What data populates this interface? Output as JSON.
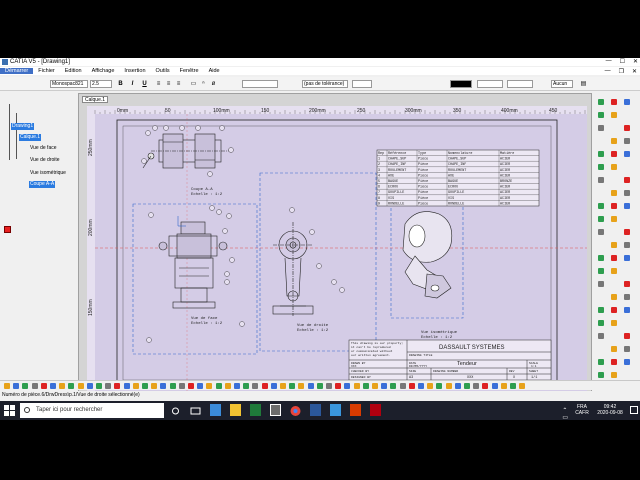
{
  "window": {
    "title": "CATIA V5 - [Drawing1]",
    "controls": [
      "—",
      "☐",
      "✕"
    ],
    "inner_controls": [
      "—",
      "❐",
      "✕"
    ]
  },
  "menu": {
    "items": [
      "Démarrer",
      "Fichier",
      "Edition",
      "Affichage",
      "Insertion",
      "Outils",
      "Fenêtre",
      "Aide"
    ],
    "active_index": 0
  },
  "toolbar": {
    "font_name": "Monospac821",
    "font_size": "2.5",
    "bold": "B",
    "italic": "I",
    "underline": "U",
    "tolerance": "(pas de tolérance)",
    "line_type": "Aucun"
  },
  "tree": {
    "root": "Drawing1",
    "sheet": "Calque.1",
    "views": [
      "Vue de face",
      "Vue de droite",
      "Vue isométrique",
      "Coupe A-A"
    ],
    "selected": [
      "Drawing1",
      "Calque.1",
      "Coupe A-A"
    ]
  },
  "sheet_tab": "Calque.1",
  "ruler": {
    "labels": [
      "0mm",
      "50",
      "100mm",
      "150",
      "200mm",
      "250",
      "300mm",
      "350",
      "400mm",
      "450"
    ],
    "vlabels": [
      "250mm",
      "200mm",
      "150mm"
    ]
  },
  "drawing": {
    "view_labels": {
      "section": [
        "Coupe A-A",
        "Echelle : 1:2"
      ],
      "front": [
        "Vue de face",
        "Echelle : 1:2"
      ],
      "right": [
        "Vue de droite",
        "Echelle : 1:2"
      ],
      "iso": [
        "Vue isométrique",
        "Echelle : 1:2"
      ]
    },
    "bom_headers": [
      "Rep",
      "Référence",
      "Type",
      "Nomenclature",
      "Matière"
    ],
    "bom_rows": [
      [
        "1",
        "CHAPE_SUP",
        "Pièce",
        "CHAPE_SUP",
        "ACIER"
      ],
      [
        "2",
        "CHAPE_INF",
        "Pièce",
        "CHAPE_INF",
        "ACIER"
      ],
      [
        "3",
        "ROULEMENT",
        "Pièce",
        "ROULEMENT",
        "ACIER"
      ],
      [
        "4",
        "AXE",
        "Pièce",
        "AXE",
        "ACIER"
      ],
      [
        "5",
        "BAGUE",
        "Pièce",
        "BAGUE",
        "BRONZE"
      ],
      [
        "6",
        "ECROU",
        "Pièce",
        "ECROU",
        "ACIER"
      ],
      [
        "7",
        "GOUPILLE",
        "Pièce",
        "GOUPILLE",
        "ACIER"
      ],
      [
        "8",
        "VIS",
        "Pièce",
        "VIS",
        "ACIER"
      ],
      [
        "9",
        "RONDELLE",
        "Pièce",
        "RONDELLE",
        "ACIER"
      ]
    ],
    "title_block": {
      "company": "DASSAULT SYSTEMES",
      "notice": [
        "This drawing is our property;",
        "it can't be reproduced",
        "or communicated without",
        "our written agreement."
      ],
      "title": "Tendeur",
      "drawing_title_label": "DRAWING TITLE",
      "drawn_by": "DRAWN BY",
      "drawn_by_value": "XXX",
      "date_label": "DATE",
      "date_value": "DD/MM/YYYY",
      "checked_by": "CHECKED BY",
      "size_label": "SIZE",
      "size_value": "A3",
      "drawing_number_label": "DRAWING NUMBER",
      "rev_label": "REV",
      "rev_value": "X",
      "designed_by": "DESIGNED BY",
      "scale_label": "SCALE",
      "scale_value": "1:1",
      "weight_label": "WEIGHT(kg)",
      "sheet_label": "SHEET",
      "sheet_value": "1/1",
      "misc_values": [
        "XXX",
        "XXX"
      ]
    }
  },
  "status": "Numéro de pièce.6/DrwDress\\p.1/Vue de droite sélectionné(e)",
  "taskbar": {
    "search_placeholder": "Taper ici pour rechercher",
    "language": "FRA",
    "language_sub": "CAFR",
    "time": "09:42",
    "date": "2020-09-08"
  },
  "colors": {
    "canvas_bg": "#d4cce6",
    "selection_blue": "#2b7be0",
    "view_frame": "#3366cc",
    "axis_line": "#e05050",
    "taskbar": "#1c1f2b"
  }
}
